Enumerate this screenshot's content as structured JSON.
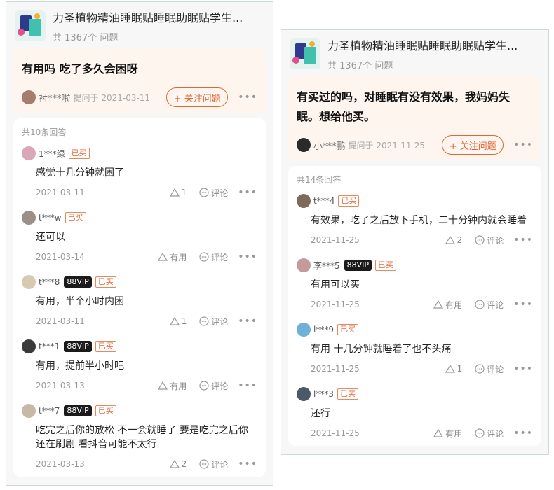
{
  "left": {
    "product": {
      "title": "力圣植物精油睡眠贴睡眠助眠贴学生...",
      "qcount": "共 1367个 问题"
    },
    "question": {
      "text": "有用吗 吃了多久会困呀",
      "asker": "衬***啦",
      "date": "提问于 2021-03-11",
      "follow": "+ 关注问题"
    },
    "answers_count": "共10条回答",
    "answers": [
      {
        "user": "1***绿",
        "vip": "",
        "bought": "已买",
        "text": "感觉十几分钟就困了",
        "date": "2021-03-11",
        "likes": "1",
        "comment": "评论"
      },
      {
        "user": "t***w",
        "vip": "",
        "bought": "已买",
        "text": "还可以",
        "date": "2021-03-14",
        "likes": "有用",
        "comment": "评论"
      },
      {
        "user": "t***8",
        "vip": "88VIP",
        "bought": "已买",
        "text": "有用，半个小时内困",
        "date": "2021-03-11",
        "likes": "1",
        "comment": "评论"
      },
      {
        "user": "t***1",
        "vip": "88VIP",
        "bought": "已买",
        "text": "有用，提前半小时吧",
        "date": "2021-03-13",
        "likes": "有用",
        "comment": "评论"
      },
      {
        "user": "t***7",
        "vip": "88VIP",
        "bought": "已买",
        "text": "吃完之后你的放松 不一会就睡了 要是吃完之后你还在刷剧 看抖音可能不太行",
        "date": "2021-03-13",
        "likes": "2",
        "comment": "评论"
      }
    ]
  },
  "right": {
    "product": {
      "title": "力圣植物精油睡眠贴睡眠助眠贴学生...",
      "qcount": "共 1367个 问题"
    },
    "question": {
      "text": "有买过的吗，对睡眠有没有效果，我妈妈失眠。想给他买。",
      "asker": "小***鹏",
      "date": "提问于 2021-11-25",
      "follow": "+ 关注问题"
    },
    "answers_count": "共14条回答",
    "answers": [
      {
        "user": "t***4",
        "vip": "",
        "bought": "已买",
        "text": "有效果，吃了之后放下手机，二十分钟内就会睡着",
        "date": "2021-11-25",
        "likes": "2",
        "comment": "评论"
      },
      {
        "user": "李***5",
        "vip": "88VIP",
        "bought": "已买",
        "text": "有用可以买",
        "date": "2021-11-25",
        "likes": "有用",
        "comment": "评论"
      },
      {
        "user": "l***9",
        "vip": "",
        "bought": "已买",
        "text": "有用 十几分钟就睡着了也不头痛",
        "date": "2021-11-25",
        "likes": "1",
        "comment": "评论"
      },
      {
        "user": "l***3",
        "vip": "",
        "bought": "已买",
        "text": "还行",
        "date": "2021-11-25",
        "likes": "有用",
        "comment": "评论"
      }
    ]
  },
  "avatar_colors": [
    "#a67c6d",
    "#d9a7b7",
    "#9c8f86",
    "#d8c9b4",
    "#3a3a3a",
    "#c7b9a8",
    "#7f6a5a",
    "#c49a9a",
    "#6fb0d8",
    "#4a5a6a"
  ],
  "icons": {
    "more": "more-dots-icon",
    "like": "triangle-like-icon",
    "comment": "comment-bubble-icon"
  }
}
